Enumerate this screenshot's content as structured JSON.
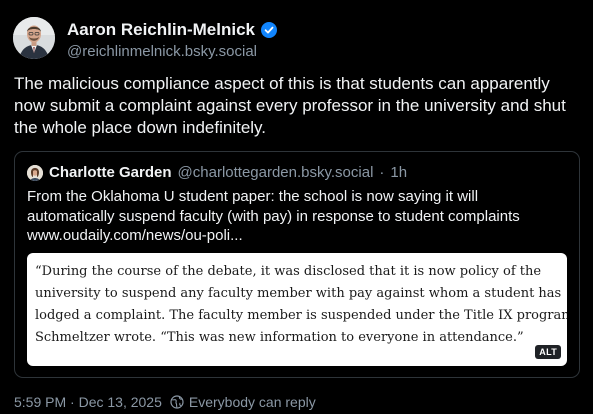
{
  "post": {
    "author": {
      "display_name": "Aaron Reichlin-Melnick",
      "handle": "@reichlinmelnick.bsky.social",
      "verified": true
    },
    "text": "The malicious compliance aspect of this is that students can apparently now submit a complaint against every professor in the university and shut the whole place down indefinitely."
  },
  "quote": {
    "author": {
      "display_name": "Charlotte Garden",
      "handle": "@charlottegarden.bsky.social",
      "separator": "·",
      "time": "1h"
    },
    "body_lines": [
      "From the Oklahoma U student paper: the school is now saying it will",
      "automatically suspend faculty (with pay) in response to student complaints",
      "www.oudaily.com/news/ou-poli..."
    ],
    "image": {
      "text_lines": [
        "“During the course of the debate, it was disclosed that it is now policy of the",
        "university to suspend any faculty member with pay against whom a student has",
        "lodged a complaint. The faculty member is suspended under the Title IX program,”",
        "Schmeltzer wrote. “This was new information to everyone in attendance.”"
      ],
      "alt_badge": "ALT"
    }
  },
  "footer": {
    "timestamp": "5:59 PM · Dec 13, 2025",
    "reply_setting": "Everybody can reply"
  },
  "colors": {
    "background": "#000000",
    "text_primary": "#f1f3f5",
    "text_secondary": "#8b98a5",
    "verified": "#1185fe",
    "border": "#2e3439"
  },
  "icons": {
    "verified": "verified-check-icon",
    "reply_setting": "globe-icon"
  }
}
